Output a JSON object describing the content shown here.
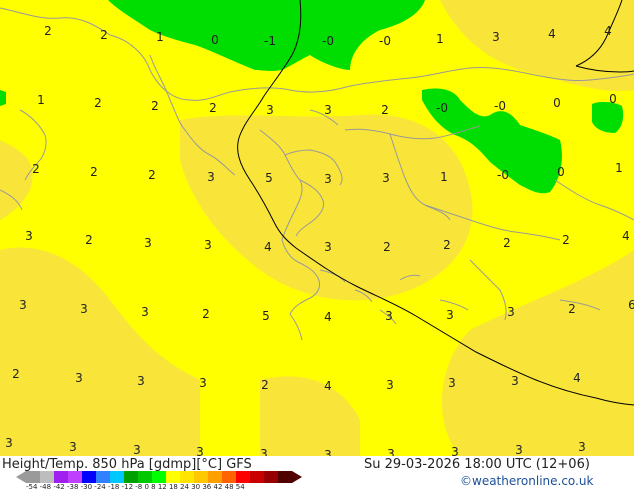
{
  "map": {
    "field_labels": [
      {
        "t": "2",
        "p": [
          48,
          35
        ]
      },
      {
        "t": "2",
        "p": [
          104,
          39
        ]
      },
      {
        "t": "1",
        "p": [
          160,
          41
        ]
      },
      {
        "t": "0",
        "p": [
          215,
          44
        ]
      },
      {
        "t": "-1",
        "p": [
          270,
          45
        ]
      },
      {
        "t": "-0",
        "p": [
          328,
          45
        ]
      },
      {
        "t": "-0",
        "p": [
          385,
          45
        ]
      },
      {
        "t": "1",
        "p": [
          440,
          43
        ]
      },
      {
        "t": "3",
        "p": [
          496,
          41
        ]
      },
      {
        "t": "4",
        "p": [
          552,
          38
        ]
      },
      {
        "t": "4",
        "p": [
          608,
          35
        ]
      },
      {
        "t": "1",
        "p": [
          41,
          104
        ]
      },
      {
        "t": "2",
        "p": [
          98,
          107
        ]
      },
      {
        "t": "2",
        "p": [
          155,
          110
        ]
      },
      {
        "t": "2",
        "p": [
          213,
          112
        ]
      },
      {
        "t": "3",
        "p": [
          270,
          114
        ]
      },
      {
        "t": "3",
        "p": [
          328,
          114
        ]
      },
      {
        "t": "2",
        "p": [
          385,
          114
        ]
      },
      {
        "t": "-0",
        "p": [
          442,
          112
        ]
      },
      {
        "t": "-0",
        "p": [
          500,
          110
        ]
      },
      {
        "t": "0",
        "p": [
          557,
          107
        ]
      },
      {
        "t": "0",
        "p": [
          613,
          103
        ]
      },
      {
        "t": "2",
        "p": [
          36,
          173
        ]
      },
      {
        "t": "2",
        "p": [
          94,
          176
        ]
      },
      {
        "t": "2",
        "p": [
          152,
          179
        ]
      },
      {
        "t": "3",
        "p": [
          211,
          181
        ]
      },
      {
        "t": "5",
        "p": [
          269,
          182
        ]
      },
      {
        "t": "3",
        "p": [
          328,
          183
        ]
      },
      {
        "t": "3",
        "p": [
          386,
          182
        ]
      },
      {
        "t": "1",
        "p": [
          444,
          181
        ]
      },
      {
        "t": "-0",
        "p": [
          503,
          179
        ]
      },
      {
        "t": "0",
        "p": [
          561,
          176
        ]
      },
      {
        "t": "1",
        "p": [
          619,
          172
        ]
      },
      {
        "t": "3",
        "p": [
          29,
          240
        ]
      },
      {
        "t": "2",
        "p": [
          89,
          244
        ]
      },
      {
        "t": "3",
        "p": [
          148,
          247
        ]
      },
      {
        "t": "3",
        "p": [
          208,
          249
        ]
      },
      {
        "t": "4",
        "p": [
          268,
          251
        ]
      },
      {
        "t": "3",
        "p": [
          328,
          251
        ]
      },
      {
        "t": "2",
        "p": [
          387,
          251
        ]
      },
      {
        "t": "2",
        "p": [
          447,
          249
        ]
      },
      {
        "t": "2",
        "p": [
          507,
          247
        ]
      },
      {
        "t": "2",
        "p": [
          566,
          244
        ]
      },
      {
        "t": "4",
        "p": [
          626,
          240
        ]
      },
      {
        "t": "3",
        "p": [
          23,
          309
        ]
      },
      {
        "t": "3",
        "p": [
          84,
          313
        ]
      },
      {
        "t": "3",
        "p": [
          145,
          316
        ]
      },
      {
        "t": "2",
        "p": [
          206,
          318
        ]
      },
      {
        "t": "5",
        "p": [
          266,
          320
        ]
      },
      {
        "t": "4",
        "p": [
          328,
          321
        ]
      },
      {
        "t": "3",
        "p": [
          389,
          320
        ]
      },
      {
        "t": "3",
        "p": [
          450,
          319
        ]
      },
      {
        "t": "3",
        "p": [
          511,
          316
        ]
      },
      {
        "t": "2",
        "p": [
          572,
          313
        ]
      },
      {
        "t": "6",
        "p": [
          632,
          309
        ]
      },
      {
        "t": "2",
        "p": [
          16,
          378
        ]
      },
      {
        "t": "3",
        "p": [
          79,
          382
        ]
      },
      {
        "t": "3",
        "p": [
          141,
          385
        ]
      },
      {
        "t": "3",
        "p": [
          203,
          387
        ]
      },
      {
        "t": "2",
        "p": [
          265,
          389
        ]
      },
      {
        "t": "4",
        "p": [
          328,
          390
        ]
      },
      {
        "t": "3",
        "p": [
          390,
          389
        ]
      },
      {
        "t": "3",
        "p": [
          452,
          387
        ]
      },
      {
        "t": "3",
        "p": [
          515,
          385
        ]
      },
      {
        "t": "4",
        "p": [
          577,
          382
        ]
      },
      {
        "t": "3",
        "p": [
          9,
          447
        ]
      },
      {
        "t": "3",
        "p": [
          73,
          451
        ]
      },
      {
        "t": "3",
        "p": [
          137,
          454
        ]
      },
      {
        "t": "3",
        "p": [
          200,
          456
        ]
      },
      {
        "t": "3",
        "p": [
          264,
          458
        ]
      },
      {
        "t": "3",
        "p": [
          328,
          459
        ]
      },
      {
        "t": "3",
        "p": [
          391,
          458
        ]
      },
      {
        "t": "3",
        "p": [
          455,
          456
        ]
      },
      {
        "t": "3",
        "p": [
          519,
          454
        ]
      },
      {
        "t": "3",
        "p": [
          582,
          451
        ]
      }
    ],
    "colors": {
      "bg": "#ffff00",
      "warm": "#f9e53a",
      "cold": "#00dd00",
      "land": "#999999",
      "contour": "#000000"
    }
  },
  "footer": {
    "title": "Height/Temp. 850 hPa [gdmp][°C] GFS",
    "datetime": "Su 29-03-2026 18:00 UTC (12+06)",
    "credit": "©weatheronline.co.uk",
    "scale_ticks": "-54 -48 -42 -38 -30 -24 -18 -12 -8  0  8  12  18  24  30  36  42  48  54",
    "scale_colors": [
      "#9a9a9a",
      "#bdbdbd",
      "#a020f0",
      "#c040ff",
      "#0000ff",
      "#3080ff",
      "#00c8ff",
      "#00a000",
      "#00c800",
      "#00ff00",
      "#ffff00",
      "#ffe600",
      "#ffc800",
      "#ffa000",
      "#ff6400",
      "#ff0000",
      "#c80000",
      "#960000",
      "#500000"
    ]
  }
}
